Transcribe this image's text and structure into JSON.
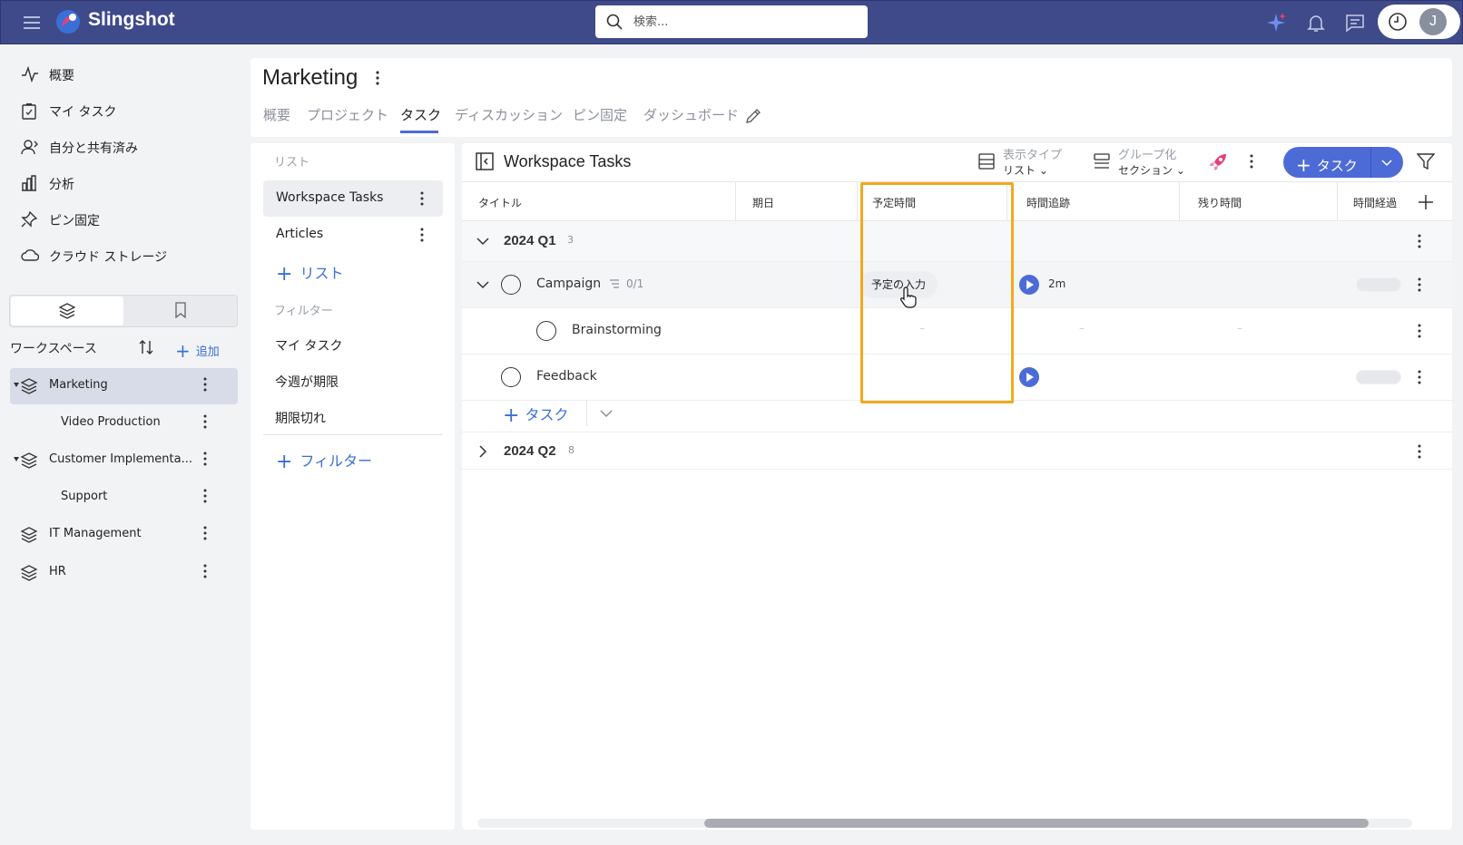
{
  "app": {
    "name": "Slingshot"
  },
  "search": {
    "placeholder": "検索..."
  },
  "user": {
    "initial": "J"
  },
  "nav": {
    "items": [
      {
        "label": "概要",
        "icon": "activity-icon"
      },
      {
        "label": "マイ タスク",
        "icon": "task-clipboard-icon"
      },
      {
        "label": "自分と共有済み",
        "icon": "shared-user-icon"
      },
      {
        "label": "分析",
        "icon": "bar-chart-icon"
      },
      {
        "label": "ピン固定",
        "icon": "pin-icon"
      },
      {
        "label": "クラウド ストレージ",
        "icon": "cloud-icon"
      }
    ]
  },
  "workspaces": {
    "label": "ワークスペース",
    "add_label": "追加",
    "items": [
      {
        "label": "Marketing"
      },
      {
        "label": "Video Production"
      },
      {
        "label": "Customer Implementa..."
      },
      {
        "label": "Support"
      },
      {
        "label": "IT Management"
      },
      {
        "label": "HR"
      }
    ]
  },
  "page": {
    "title": "Marketing",
    "tabs": [
      "概要",
      "プロジェクト",
      "タスク",
      "ディスカッション",
      "ピン固定",
      "ダッシュボード"
    ],
    "active_tab": "タスク"
  },
  "lists_panel": {
    "list_header": "リスト",
    "lists": [
      "Workspace Tasks",
      "Articles"
    ],
    "add_list": "リスト",
    "filter_header": "フィルター",
    "filters": [
      "マイ タスク",
      "今週が期限",
      "期限切れ"
    ],
    "add_filter": "フィルター"
  },
  "main": {
    "title": "Workspace Tasks",
    "view_type": {
      "label": "表示タイプ",
      "value": "リスト"
    },
    "group_by": {
      "label": "グループ化",
      "value": "セクション"
    },
    "add_task": "タスク",
    "columns": [
      "タイトル",
      "期日",
      "予定時間",
      "時間追跡",
      "残り時間",
      "時間経過"
    ],
    "groups": [
      {
        "name": "2024 Q1",
        "count": "3"
      },
      {
        "name": "2024 Q2",
        "count": "8"
      }
    ],
    "tasks": {
      "campaign": {
        "name": "Campaign",
        "subtasks": "0/1",
        "estimate_button": "予定の入力",
        "tracked": "2m"
      },
      "brainstorming": {
        "name": "Brainstorming",
        "dash": "–"
      },
      "feedback": {
        "name": "Feedback"
      }
    },
    "add_task_row": "タスク"
  },
  "colors": {
    "header": "#3f4a8a",
    "accent": "#4d6bd6",
    "highlight": "#f2a91d"
  }
}
